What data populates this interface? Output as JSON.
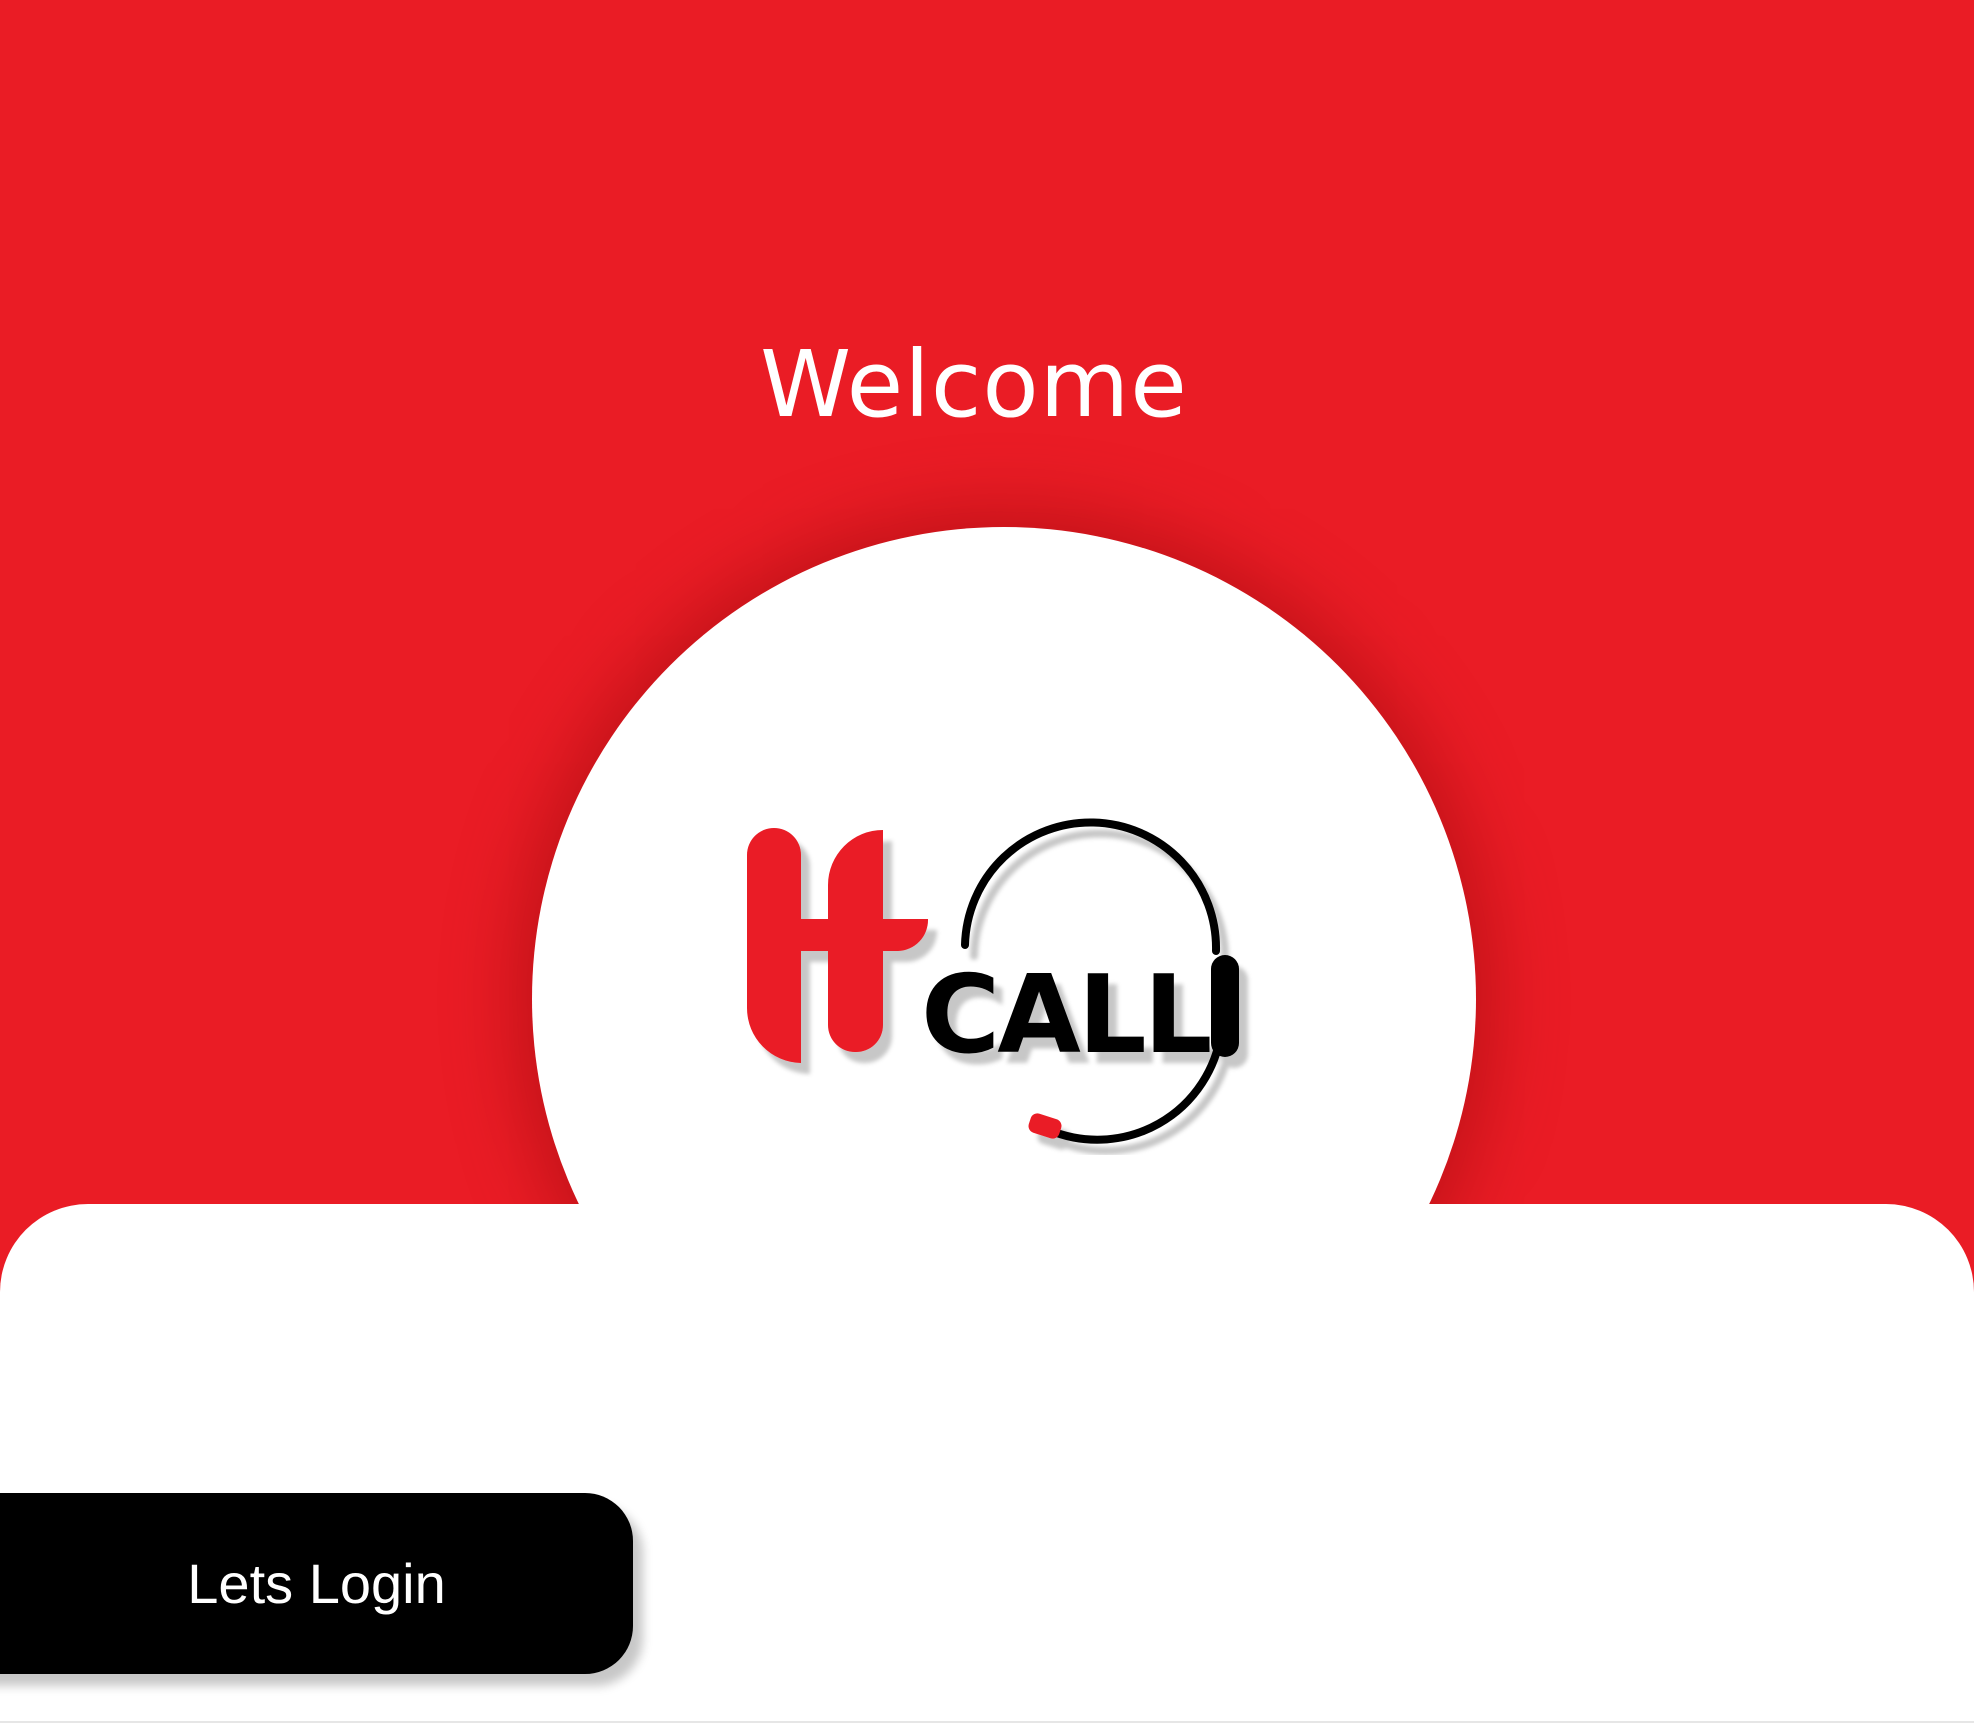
{
  "welcome": {
    "title": "Welcome"
  },
  "logo": {
    "icon": "headset-h-call-logo",
    "wordmark": "CALL",
    "brand_color": "#ea1c25",
    "ink_color": "#000000"
  },
  "login": {
    "button_label": "Lets Login"
  },
  "colors": {
    "background_red": "#ea1c25",
    "surface_white": "#ffffff",
    "button_black": "#000000"
  }
}
